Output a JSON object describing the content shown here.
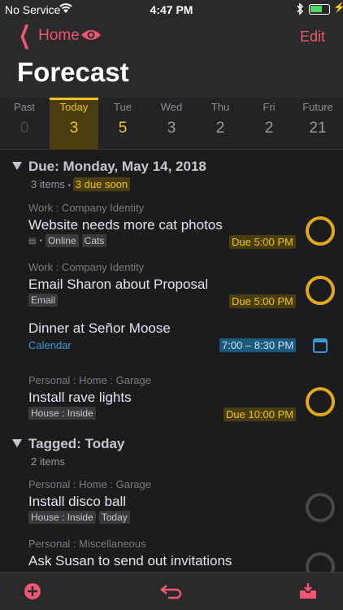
{
  "status": {
    "carrier": "No Service",
    "time": "4:47 PM"
  },
  "nav": {
    "back_label": "Home",
    "edit_label": "Edit",
    "title": "Forecast"
  },
  "days": [
    {
      "name": "Past",
      "count": "0"
    },
    {
      "name": "Today",
      "count": "3"
    },
    {
      "name": "Tue",
      "count": "5"
    },
    {
      "name": "Wed",
      "count": "3"
    },
    {
      "name": "Thu",
      "count": "2"
    },
    {
      "name": "Fri",
      "count": "2"
    },
    {
      "name": "Future",
      "count": "21"
    }
  ],
  "section_due": {
    "title": "Due: Monday, May 14, 2018",
    "items": "3 items",
    "soon": "3 due soon"
  },
  "tasks": [
    {
      "project": "Work : Company Identity",
      "name": "Website needs more cat photos",
      "tags": [
        "Online",
        "Cats"
      ],
      "due": "Due 5:00 PM"
    },
    {
      "project": "Work : Company Identity",
      "name": "Email Sharon about Proposal",
      "tags": [
        "Email"
      ],
      "due": "Due 5:00 PM"
    },
    {
      "name": "Dinner at Señor Moose",
      "calendar": "Calendar",
      "time": "7:00 – 8:30 PM"
    },
    {
      "project": "Personal : Home : Garage",
      "name": "Install rave lights",
      "tags": [
        "House : Inside"
      ],
      "due": "Due 10:00 PM"
    }
  ],
  "section_tagged": {
    "title": "Tagged: Today",
    "items": "2 items"
  },
  "tagged_tasks": [
    {
      "project": "Personal : Home : Garage",
      "name": "Install disco ball",
      "tags": [
        "House : Inside",
        "Today"
      ]
    },
    {
      "project": "Personal : Miscellaneous",
      "name": "Ask Susan to send out invitations"
    }
  ],
  "colors": {
    "accent": "#f0566f",
    "due": "#f0c419",
    "calendar": "#3a9ad9"
  },
  "icons": [
    "wifi-icon",
    "bluetooth-icon",
    "battery-icon",
    "eye-icon",
    "add-icon",
    "undo-icon",
    "inbox-icon"
  ]
}
